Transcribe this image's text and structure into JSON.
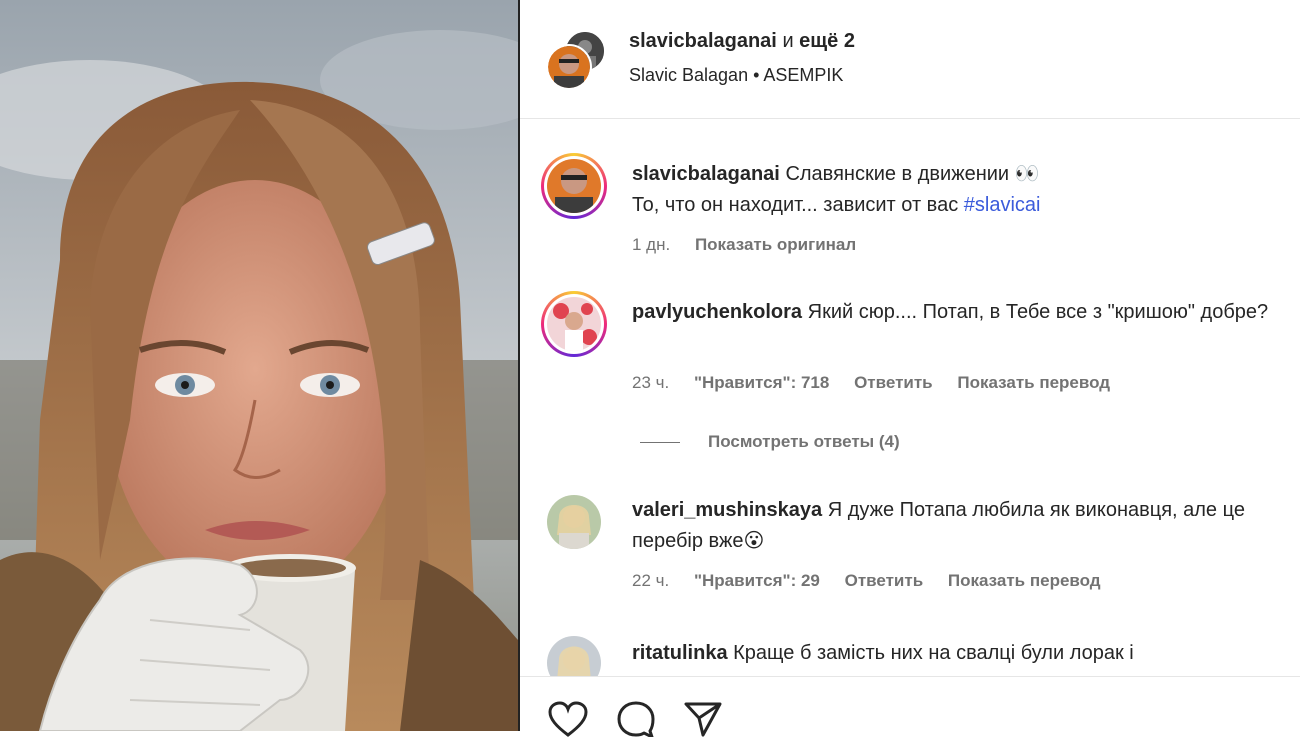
{
  "header": {
    "username": "slavicbalaganai",
    "and_label": "и",
    "others": "ещё 2",
    "subtitle": "Slavic Balagan • ASEMPIK"
  },
  "comments": [
    {
      "username": "slavicbalaganai",
      "text": "Славянские в движении 👀",
      "line2": "То, что он находит... зависит от вас ",
      "hashtag": "#slavicai",
      "time": "1 дн.",
      "action": "Показать оригинал"
    },
    {
      "username": "pavlyuchenkolora",
      "text": "Який сюр.... Потап, в Тебе все з \"кришою\" добре?",
      "time": "23 ч.",
      "likes": "\"Нравится\": 718",
      "reply": "Ответить",
      "translate": "Показать перевод"
    },
    {
      "username": "valeri_mushinskaya",
      "text": "Я дуже Потапа любила як виконавця, але це перебір вже😮",
      "time": "22 ч.",
      "likes": "\"Нравится\": 29",
      "reply": "Ответить",
      "translate": "Показать перевод"
    },
    {
      "username": "ritatulinka",
      "text": "Краще б замість них на свалці були лорак і"
    }
  ],
  "view_replies": "Посмотреть ответы (4)",
  "icons": {
    "like": "heart-icon",
    "comment": "comment-icon",
    "share": "send-icon"
  },
  "colors": {
    "hashtag": "#3b5bdb",
    "meta": "#737373"
  }
}
